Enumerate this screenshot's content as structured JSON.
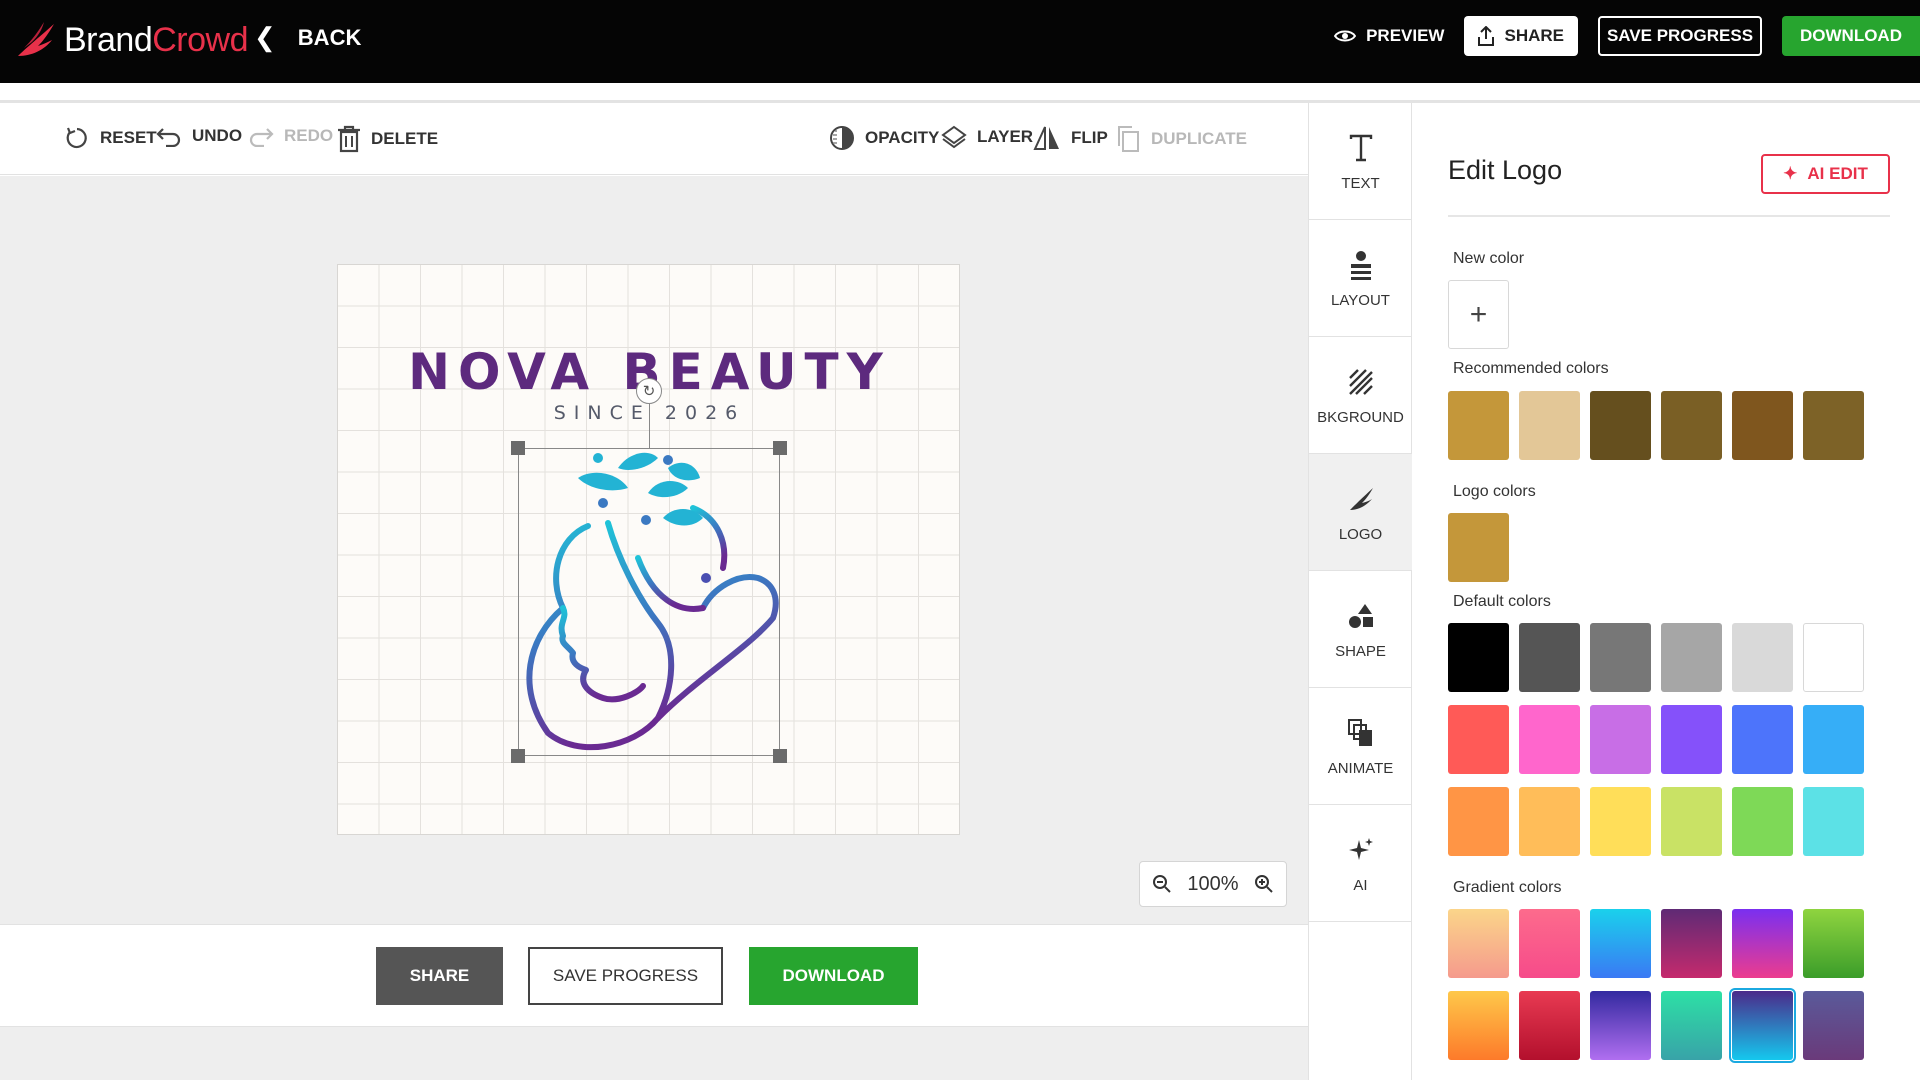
{
  "brand": {
    "name_part1": "Brand",
    "name_part2": "Crowd"
  },
  "nav": {
    "back_label": "BACK"
  },
  "top_actions": {
    "preview": "PREVIEW",
    "share": "SHARE",
    "save_progress": "SAVE PROGRESS",
    "download": "DOWNLOAD"
  },
  "toolbar": {
    "reset": "RESET",
    "undo": "UNDO",
    "redo": "REDO",
    "delete": "DELETE",
    "opacity": "OPACITY",
    "layer": "LAYER",
    "flip": "FLIP",
    "duplicate": "DUPLICATE"
  },
  "canvas": {
    "logo_title": "NOVA BEAUTY",
    "logo_subtitle": "SINCE 2026",
    "zoom_level": "100%"
  },
  "bottom_actions": {
    "share": "SHARE",
    "save_progress": "SAVE PROGRESS",
    "download": "DOWNLOAD"
  },
  "side_tools": [
    {
      "label": "TEXT",
      "icon": "text-icon"
    },
    {
      "label": "LAYOUT",
      "icon": "layout-icon"
    },
    {
      "label": "BKGROUND",
      "icon": "background-icon"
    },
    {
      "label": "LOGO",
      "icon": "logo-icon",
      "active": true
    },
    {
      "label": "SHAPE",
      "icon": "shape-icon"
    },
    {
      "label": "ANIMATE",
      "icon": "animate-icon"
    },
    {
      "label": "AI",
      "icon": "ai-sparkle-icon"
    }
  ],
  "panel": {
    "title": "Edit Logo",
    "ai_edit": "AI EDIT",
    "new_color_label": "New color",
    "recommended_label": "Recommended colors",
    "recommended_colors": [
      "#c4973a",
      "#e3c797",
      "#654f1e",
      "#7a5f25",
      "#7f561e",
      "#7d6227"
    ],
    "logo_colors_label": "Logo colors",
    "logo_colors": [
      "#c4973a"
    ],
    "default_label": "Default colors",
    "default_colors": [
      "#000000",
      "#555555",
      "#777777",
      "#a6a6a6",
      "#d9d9d9",
      "#ffffff",
      "#ff5a57",
      "#ff66cc",
      "#c86ee6",
      "#8551fa",
      "#4d74fb",
      "#36aef7",
      "#ff9545",
      "#ffbd59",
      "#ffde59",
      "#c9e265",
      "#7ed957",
      "#5ce1e6"
    ],
    "gradient_label": "Gradient colors",
    "gradient_colors": [
      [
        "#fbd58a",
        "#f59a8c"
      ],
      [
        "#fd6b8c",
        "#f64b8a"
      ],
      [
        "#1ad1ec",
        "#3a79f4"
      ],
      [
        "#5f2a75",
        "#c52a6d"
      ],
      [
        "#7a2ff0",
        "#ec3c8e"
      ],
      [
        "#8fd43f",
        "#3b9d2a"
      ],
      [
        "#fec84a",
        "#fd7a2a"
      ],
      [
        "#e83a52",
        "#b3102d"
      ],
      [
        "#332aa0",
        "#b06ef0"
      ],
      [
        "#2de0a5",
        "#38a3a8"
      ],
      [
        "#4b2a8a",
        "#15c8ee"
      ],
      [
        "#5a5a9a",
        "#6a3a7a"
      ]
    ],
    "selected_gradient_index": 10
  }
}
